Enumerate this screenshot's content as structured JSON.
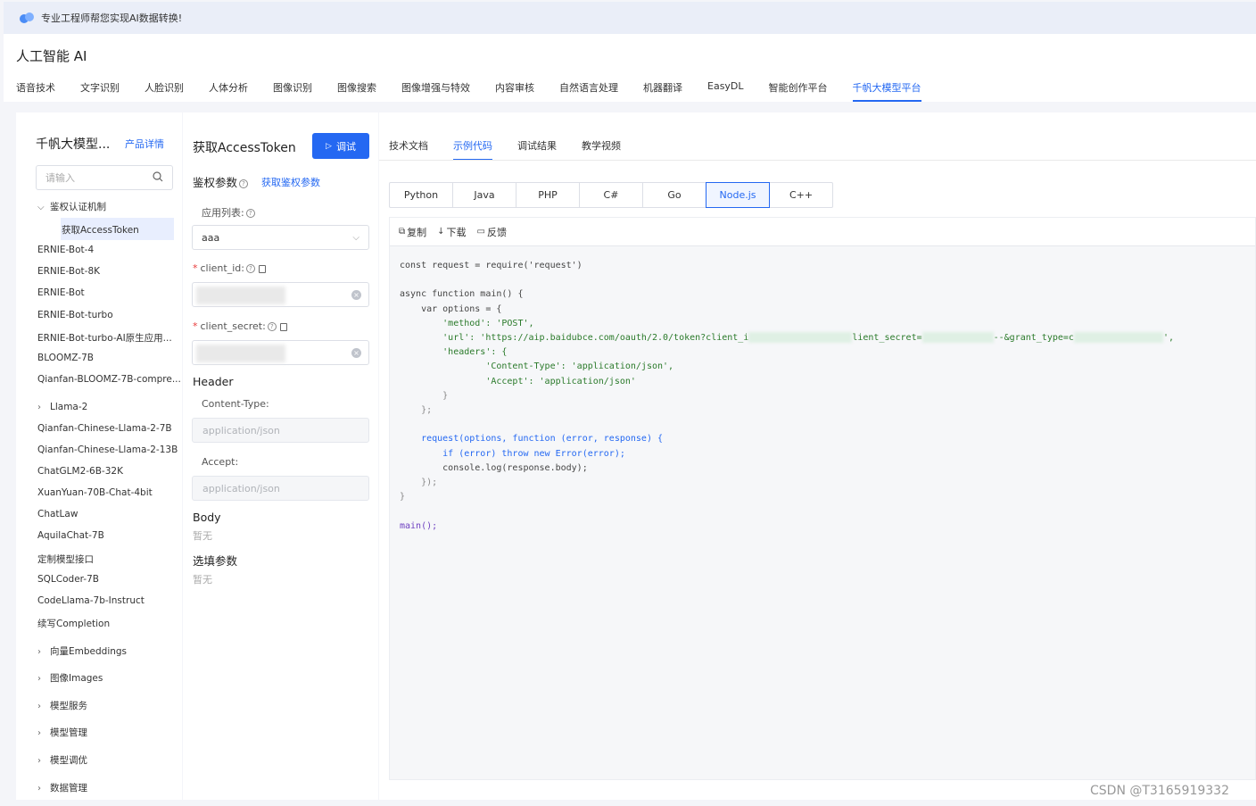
{
  "banner": {
    "text": "专业工程师帮您实现AI数据转换!"
  },
  "header": {
    "title": "人工智能 AI",
    "tabs": [
      "语音技术",
      "文字识别",
      "人脸识别",
      "人体分析",
      "图像识别",
      "图像搜索",
      "图像增强与特效",
      "内容审核",
      "自然语言处理",
      "机器翻译",
      "EasyDL",
      "智能创作平台",
      "千帆大模型平台"
    ],
    "active_tab": "千帆大模型平台"
  },
  "sidebar": {
    "title": "千帆大模型...",
    "detail_link": "产品详情",
    "search_placeholder": "请输入",
    "items": [
      {
        "label": "鉴权认证机制",
        "expandable": true,
        "expanded": true
      },
      {
        "label": "获取AccessToken",
        "selected": true
      },
      {
        "label": "ERNIE-Bot-4"
      },
      {
        "label": "ERNIE-Bot-8K"
      },
      {
        "label": "ERNIE-Bot"
      },
      {
        "label": "ERNIE-Bot-turbo"
      },
      {
        "label": "ERNIE-Bot-turbo-AI原生应用..."
      },
      {
        "label": "BLOOMZ-7B"
      },
      {
        "label": "Qianfan-BLOOMZ-7B-compre..."
      },
      {
        "label": "Llama-2",
        "expandable": true
      },
      {
        "label": "Qianfan-Chinese-Llama-2-7B"
      },
      {
        "label": "Qianfan-Chinese-Llama-2-13B"
      },
      {
        "label": "ChatGLM2-6B-32K"
      },
      {
        "label": "XuanYuan-70B-Chat-4bit"
      },
      {
        "label": "ChatLaw"
      },
      {
        "label": "AquilaChat-7B"
      },
      {
        "label": "定制模型接口"
      },
      {
        "label": "SQLCoder-7B"
      },
      {
        "label": "CodeLlama-7b-Instruct"
      },
      {
        "label": "续写Completion"
      },
      {
        "label": "向量Embeddings",
        "expandable": true
      },
      {
        "label": "图像Images",
        "expandable": true
      },
      {
        "label": "模型服务",
        "expandable": true
      },
      {
        "label": "模型管理",
        "expandable": true
      },
      {
        "label": "模型调优",
        "expandable": true
      },
      {
        "label": "数据管理",
        "expandable": true
      }
    ]
  },
  "params": {
    "title": "获取AccessToken",
    "debug_button": "调试",
    "auth_title": "鉴权参数",
    "auth_link": "获取鉴权参数",
    "app_list_label": "应用列表:",
    "app_selected": "aaa",
    "client_id_label": "client_id:",
    "client_secret_label": "client_secret:",
    "header_title": "Header",
    "content_type_label": "Content-Type:",
    "content_type_value": "application/json",
    "accept_label": "Accept:",
    "accept_value": "application/json",
    "body_title": "Body",
    "body_value": "暂无",
    "optional_title": "选填参数",
    "optional_value": "暂无"
  },
  "code_panel": {
    "tabs": [
      "技术文档",
      "示例代码",
      "调试结果",
      "教学视频"
    ],
    "active_tab": "示例代码",
    "languages": [
      "Python",
      "Java",
      "PHP",
      "C#",
      "Go",
      "Node.js",
      "C++"
    ],
    "active_language": "Node.js",
    "tools": {
      "copy": "复制",
      "download": "下载",
      "feedback": "反馈"
    },
    "code": {
      "l1": "const request = require('request')",
      "l3": "async function main() {",
      "l4": "    var options = {",
      "l5": "        'method': 'POST',",
      "l6a": "        'url': 'https://aip.baidubce.com/oauth/2.0/token?client_i",
      "l6b": "lient_secret=",
      "l6c": "--&grant_type=c",
      "l6d": "',",
      "l7": "        'headers': {",
      "l8": "                'Content-Type': 'application/json',",
      "l9": "                'Accept': 'application/json'",
      "l10": "        }",
      "l11": "    };",
      "l13": "    request(options, function (error, response) {",
      "l14": "        if (error) throw new Error(error);",
      "l15": "        console.log(response.body);",
      "l16": "    });",
      "l17": "}",
      "l19": "main();"
    }
  },
  "watermark": "CSDN @T3165919332",
  "colors": {
    "accent": "#2468f2",
    "background": "#f4f5f9"
  }
}
